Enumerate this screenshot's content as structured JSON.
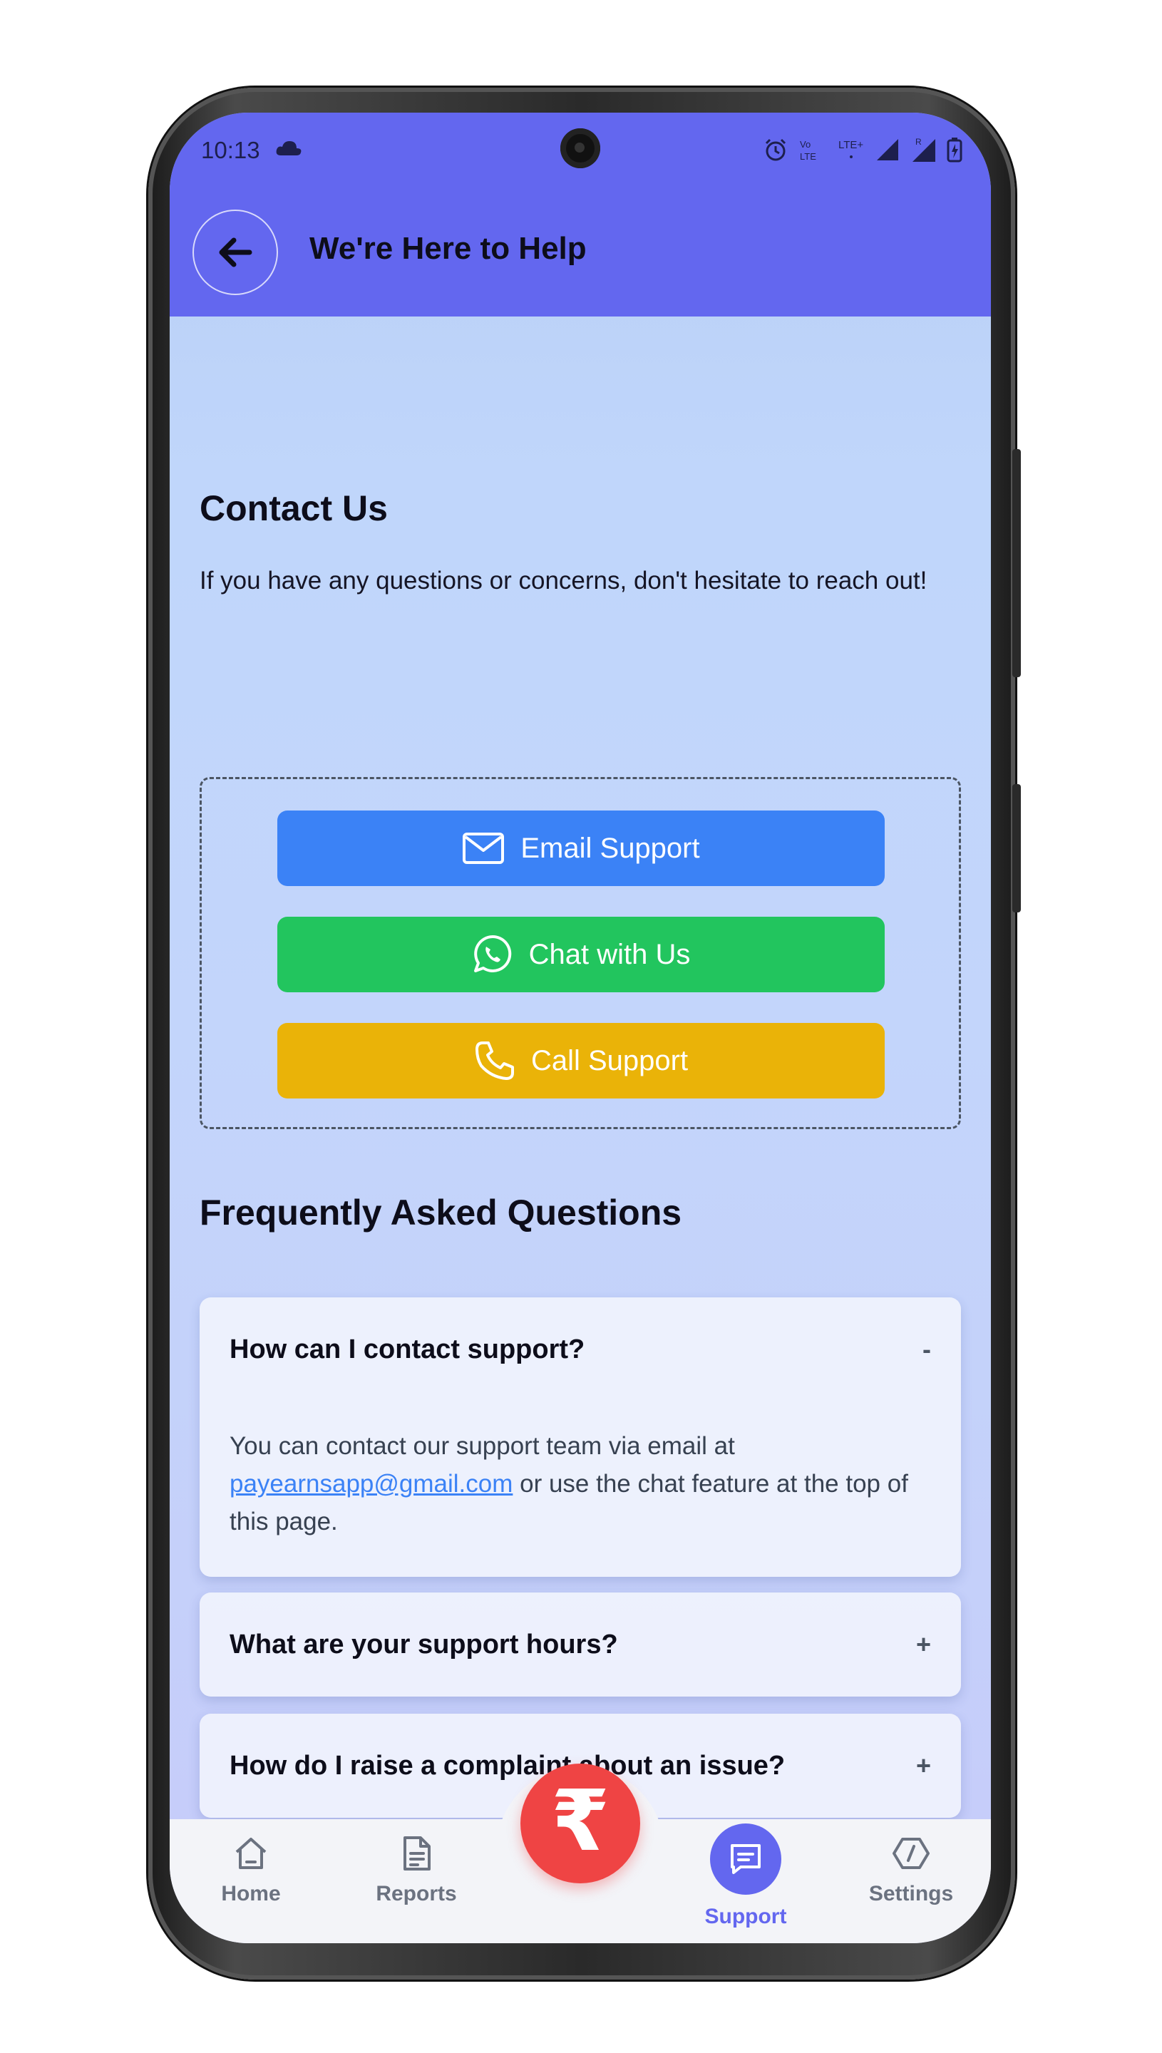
{
  "status_bar": {
    "time": "10:13"
  },
  "header": {
    "title": "We're Here to Help"
  },
  "contact": {
    "title": "Contact Us",
    "description": "If you have any questions or concerns, don't hesitate to reach out!",
    "buttons": [
      {
        "label": "Email Support",
        "icon": "mail-icon",
        "color": "#3b82f6"
      },
      {
        "label": "Chat with Us",
        "icon": "whatsapp-icon",
        "color": "#22c55e"
      },
      {
        "label": "Call Support",
        "icon": "phone-icon",
        "color": "#eab308"
      }
    ]
  },
  "faq": {
    "title": "Frequently Asked Questions",
    "items": [
      {
        "question": "How can I contact support?",
        "toggle": "-",
        "expanded": true,
        "answer_prefix": "You can contact our support team via email at ",
        "answer_link": "payearnsapp@gmail.com",
        "answer_suffix": " or use the chat feature at the top of this page."
      },
      {
        "question": "What are your support hours?",
        "toggle": "+",
        "expanded": false
      },
      {
        "question": "How do I raise a complaint about an issue?",
        "toggle": "+",
        "expanded": false
      }
    ]
  },
  "bottom_nav": {
    "items": [
      {
        "label": "Home",
        "icon": "home-icon",
        "active": false
      },
      {
        "label": "Reports",
        "icon": "document-icon",
        "active": false
      },
      {
        "label": "Support",
        "icon": "message-icon",
        "active": true
      },
      {
        "label": "Settings",
        "icon": "settings-icon",
        "active": false
      }
    ],
    "center_button": {
      "glyph": "₹",
      "color": "#ef4444"
    }
  },
  "colors": {
    "header": "#6367ef",
    "accent": "#6367ef",
    "link": "#3b82f6"
  }
}
